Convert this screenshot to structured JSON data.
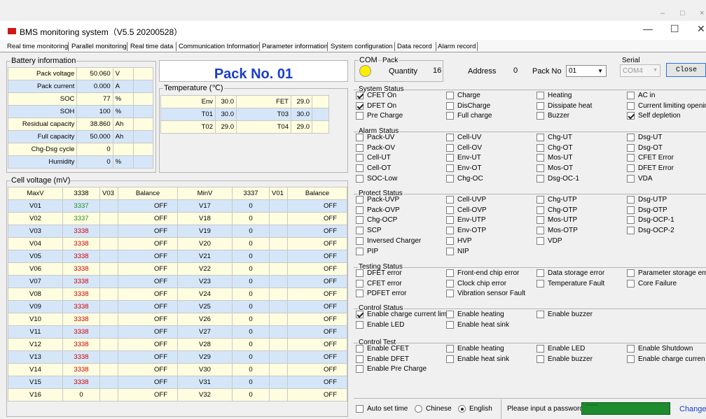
{
  "window": {
    "min": "–",
    "max": "□",
    "close": "×",
    "tb_min": "—",
    "tb_max": "☐",
    "tb_close": "✕",
    "title": "BMS monitoring system（V5.5 20200528）"
  },
  "tabs": [
    "Real time monitoring",
    "Parallel monitoring",
    "Real time data",
    "Communication Information",
    "Parameter information",
    "System configuration",
    "Data record",
    "Alarm record"
  ],
  "battery": {
    "title": "Battery information",
    "rows": [
      {
        "label": "Pack voltage",
        "value": "50.060",
        "unit": "V"
      },
      {
        "label": "Pack current",
        "value": "0.000",
        "unit": "A"
      },
      {
        "label": "SOC",
        "value": "77",
        "unit": "%"
      },
      {
        "label": "SOH",
        "value": "100",
        "unit": "%"
      },
      {
        "label": "Residual capacity",
        "value": "38.860",
        "unit": "Ah"
      },
      {
        "label": "Full capacity",
        "value": "50.000",
        "unit": "Ah"
      },
      {
        "label": "Chg-Dsg cycle",
        "value": "0",
        "unit": ""
      },
      {
        "label": "Humidity",
        "value": "0",
        "unit": "%"
      }
    ]
  },
  "pack_title": "Pack No. 01",
  "temperature": {
    "title": "Temperature (℃)",
    "rows": [
      {
        "l1": "Env",
        "v1": "30.0",
        "l2": "FET",
        "v2": "29.0"
      },
      {
        "l1": "T01",
        "v1": "30.0",
        "l2": "T03",
        "v2": "30.0"
      },
      {
        "l1": "T02",
        "v1": "29.0",
        "l2": "T04",
        "v2": "29.0"
      }
    ]
  },
  "cells": {
    "title": "Cell voltage (mV)",
    "header": {
      "maxv": "MaxV",
      "maxval": "3338",
      "maxcell": "V03",
      "bal1": "Balance",
      "minv": "MinV",
      "minval": "3337",
      "mincell": "V01",
      "bal2": "Balance"
    },
    "rows": [
      {
        "n1": "V01",
        "v1": "3337",
        "b1": "OFF",
        "n2": "V17",
        "v2": "0",
        "b2": "OFF"
      },
      {
        "n1": "V02",
        "v1": "3337",
        "b1": "OFF",
        "n2": "V18",
        "v2": "0",
        "b2": "OFF"
      },
      {
        "n1": "V03",
        "v1": "3338",
        "b1": "OFF",
        "n2": "V19",
        "v2": "0",
        "b2": "OFF"
      },
      {
        "n1": "V04",
        "v1": "3338",
        "b1": "OFF",
        "n2": "V20",
        "v2": "0",
        "b2": "OFF"
      },
      {
        "n1": "V05",
        "v1": "3338",
        "b1": "OFF",
        "n2": "V21",
        "v2": "0",
        "b2": "OFF"
      },
      {
        "n1": "V06",
        "v1": "3338",
        "b1": "OFF",
        "n2": "V22",
        "v2": "0",
        "b2": "OFF"
      },
      {
        "n1": "V07",
        "v1": "3338",
        "b1": "OFF",
        "n2": "V23",
        "v2": "0",
        "b2": "OFF"
      },
      {
        "n1": "V08",
        "v1": "3338",
        "b1": "OFF",
        "n2": "V24",
        "v2": "0",
        "b2": "OFF"
      },
      {
        "n1": "V09",
        "v1": "3338",
        "b1": "OFF",
        "n2": "V25",
        "v2": "0",
        "b2": "OFF"
      },
      {
        "n1": "V10",
        "v1": "3338",
        "b1": "OFF",
        "n2": "V26",
        "v2": "0",
        "b2": "OFF"
      },
      {
        "n1": "V11",
        "v1": "3338",
        "b1": "OFF",
        "n2": "V27",
        "v2": "0",
        "b2": "OFF"
      },
      {
        "n1": "V12",
        "v1": "3338",
        "b1": "OFF",
        "n2": "V28",
        "v2": "0",
        "b2": "OFF"
      },
      {
        "n1": "V13",
        "v1": "3338",
        "b1": "OFF",
        "n2": "V29",
        "v2": "0",
        "b2": "OFF"
      },
      {
        "n1": "V14",
        "v1": "3338",
        "b1": "OFF",
        "n2": "V30",
        "v2": "0",
        "b2": "OFF"
      },
      {
        "n1": "V15",
        "v1": "3338",
        "b1": "OFF",
        "n2": "V31",
        "v2": "0",
        "b2": "OFF"
      },
      {
        "n1": "V16",
        "v1": "0",
        "b1": "OFF",
        "n2": "V32",
        "v2": "0",
        "b2": "OFF"
      }
    ]
  },
  "com": {
    "com_label": "COM",
    "pack_label": "Pack",
    "quantity_label": "Quantity",
    "quantity_value": "16",
    "address_label": "Address",
    "address_value": "0",
    "packno_label": "Pack No",
    "packno_value": "01",
    "serial_label": "Serial",
    "serial_value": "COM4",
    "close_label": "Close"
  },
  "sections": [
    {
      "title": "System Status",
      "items": [
        [
          "CFET On",
          true
        ],
        [
          "Charge",
          false
        ],
        [
          "Heating",
          false
        ],
        [
          "AC in",
          false
        ],
        [
          "DFET On",
          true
        ],
        [
          "DisCharge",
          false
        ],
        [
          "Dissipate heat",
          false
        ],
        [
          "Current limiting opening",
          false
        ],
        [
          "Pre Charge",
          false
        ],
        [
          "Full charge",
          false
        ],
        [
          "Buzzer",
          false
        ],
        [
          "Self depletion",
          true
        ]
      ]
    },
    {
      "title": "Alarm Status",
      "items": [
        [
          "Pack-UV",
          false
        ],
        [
          "Cell-UV",
          false
        ],
        [
          "Chg-UT",
          false
        ],
        [
          "Dsg-UT",
          false
        ],
        [
          "Pack-OV",
          false
        ],
        [
          "Cell-OV",
          false
        ],
        [
          "Chg-OT",
          false
        ],
        [
          "Dsg-OT",
          false
        ],
        [
          "Cell-UT",
          false
        ],
        [
          "Env-UT",
          false
        ],
        [
          "Mos-UT",
          false
        ],
        [
          "CFET Error",
          false
        ],
        [
          "Cell-OT",
          false
        ],
        [
          "Env-OT",
          false
        ],
        [
          "Mos-OT",
          false
        ],
        [
          "DFET Error",
          false
        ],
        [
          "SOC-Low",
          false
        ],
        [
          "Chg-OC",
          false
        ],
        [
          "Dsg-OC-1",
          false
        ],
        [
          "VDA",
          false
        ]
      ]
    },
    {
      "title": "Protect Status",
      "items": [
        [
          "Pack-UVP",
          false
        ],
        [
          "Cell-UVP",
          false
        ],
        [
          "Chg-UTP",
          false
        ],
        [
          "Dsg-UTP",
          false
        ],
        [
          "Pack-OVP",
          false
        ],
        [
          "Cell-OVP",
          false
        ],
        [
          "Chg-OTP",
          false
        ],
        [
          "Dsg-OTP",
          false
        ],
        [
          "Chg-OCP",
          false
        ],
        [
          "Env-UTP",
          false
        ],
        [
          "Mos-UTP",
          false
        ],
        [
          "Dsg-OCP-1",
          false
        ],
        [
          "SCP",
          false
        ],
        [
          "Env-OTP",
          false
        ],
        [
          "Mos-OTP",
          false
        ],
        [
          "Dsg-OCP-2",
          false
        ],
        [
          "Inversed Charger",
          false
        ],
        [
          "HVP",
          false
        ],
        [
          "VDP",
          false
        ],
        null,
        [
          "PIP",
          false
        ],
        [
          "NIP",
          false
        ]
      ]
    },
    {
      "title": "Testing Status",
      "items": [
        [
          "DFET error",
          false
        ],
        [
          "Front-end chip error",
          false
        ],
        [
          "Data storage error",
          false
        ],
        [
          "Parameter storage error",
          false
        ],
        [
          "CFET error",
          false
        ],
        [
          "Clock chip error",
          false
        ],
        [
          "Temperature Fault",
          false
        ],
        [
          "Core Failure",
          false
        ],
        [
          "PDFET error",
          false
        ],
        [
          "Vibration sensor Fault",
          false
        ]
      ]
    },
    {
      "title": "Control Status",
      "items": [
        [
          "Enable charge current limi",
          true
        ],
        [
          "Enable heating",
          false
        ],
        [
          "Enable buzzer",
          false
        ],
        null,
        [
          "Enable LED",
          false
        ],
        [
          "Enable heat sink",
          false
        ]
      ]
    },
    {
      "title": "Control Test",
      "items": [
        [
          "Enable CFET",
          false
        ],
        [
          "Enable heating",
          false
        ],
        [
          "Enable LED",
          false
        ],
        [
          "Enable Shutdown",
          false
        ],
        [
          "Enable DFET",
          false
        ],
        [
          "Enable heat sink",
          false
        ],
        [
          "Enable buzzer",
          false
        ],
        [
          "Enable charge curren",
          false
        ],
        [
          "Enable Pre Charge",
          false
        ]
      ]
    }
  ],
  "bottom": {
    "auto_set_time": "Auto set time",
    "chinese": "Chinese",
    "english": "English",
    "password_prompt": "Please input a password",
    "password_value": "********",
    "change": "Change"
  }
}
